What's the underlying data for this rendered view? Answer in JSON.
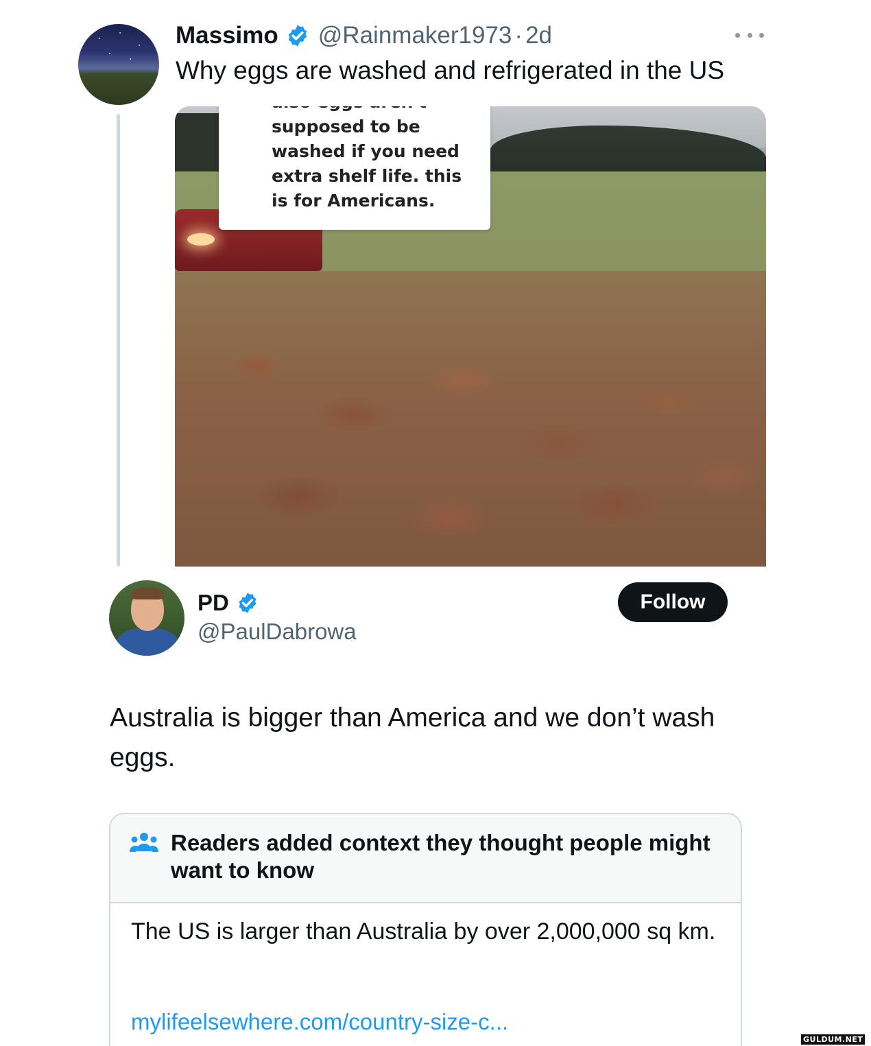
{
  "original_tweet": {
    "name": "Massimo",
    "verified": true,
    "handle": "@Rainmaker1973",
    "separator": "·",
    "time": "2d",
    "text": "Why eggs are washed and refrigerated in the US",
    "media": {
      "caption_lines": [
        "also eggs aren't",
        "supposed to be",
        "washed if you need",
        "extra shelf life. this",
        "is for Americans."
      ]
    }
  },
  "quote_tweet": {
    "name": "PD",
    "verified": true,
    "handle": "@PaulDabrowa",
    "follow_label": "Follow",
    "text": "Australia is bigger than America and we don’t wash eggs."
  },
  "community_note": {
    "icon": "readers-icon",
    "title": "Readers added context they thought people might want to know",
    "body": "The US is larger than Australia by over 2,000,000 sq km.",
    "link": "mylifeelsewhere.com/country-size-c..."
  },
  "watermark": "GULDUM.NET",
  "colors": {
    "verified_blue": "#1d9bf0",
    "text_primary": "#0f1419",
    "text_secondary": "#536471",
    "link": "#1d9bf0",
    "follow_bg": "#0f1419",
    "border": "#cfd9de"
  }
}
